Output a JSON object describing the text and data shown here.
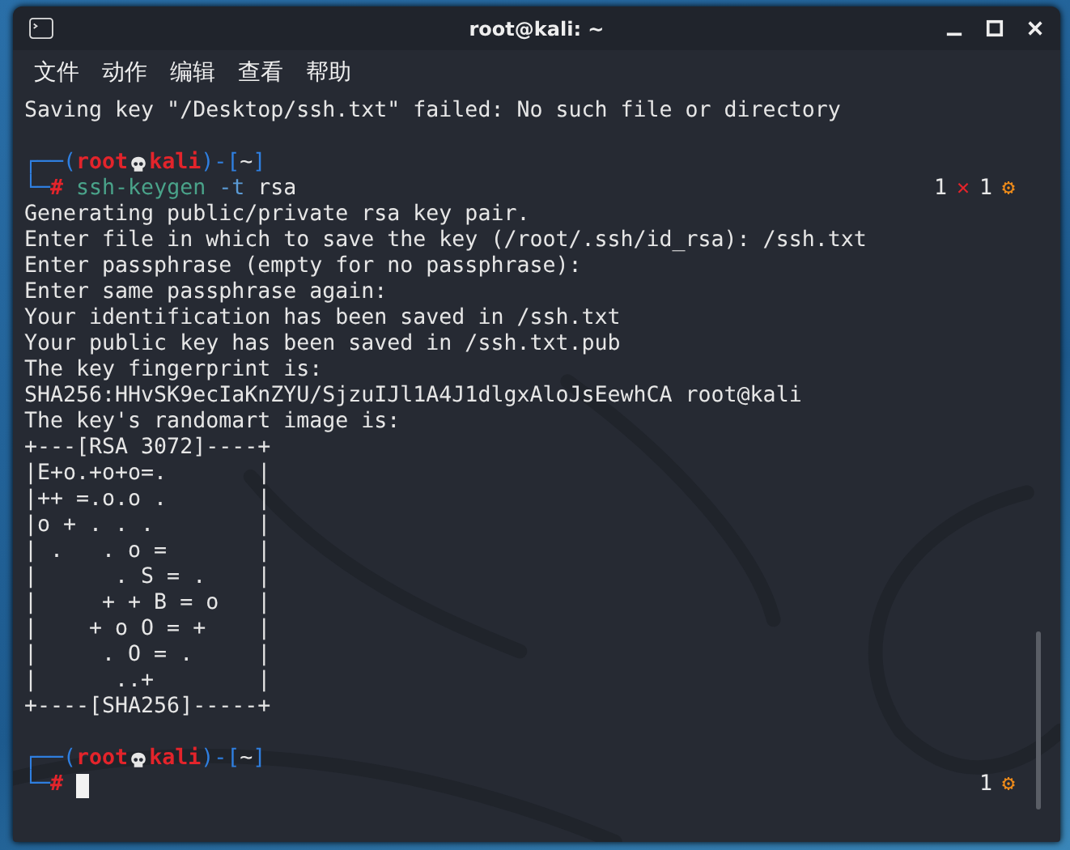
{
  "window": {
    "title": "root@kali: ~"
  },
  "menu": [
    "文件",
    "动作",
    "编辑",
    "查看",
    "帮助"
  ],
  "terminal": {
    "lines": [
      {
        "kind": "output",
        "text": "Saving key \"/Desktop/ssh.txt\" failed: No such file or directory"
      },
      {
        "kind": "blank"
      },
      {
        "kind": "prompt_head",
        "frame_left": "┌──(",
        "user": "root",
        "host": "kali",
        "frame_mid": ")-[",
        "dir": "~",
        "frame_right": "]"
      },
      {
        "kind": "prompt",
        "frame": "└─",
        "symbol": "#",
        "command": "ssh-keygen",
        "option": "-t",
        "args": "rsa",
        "status": [
          {
            "kind": "count",
            "text": "1"
          },
          {
            "kind": "error",
            "text": "✕"
          },
          {
            "kind": "count",
            "text": "1"
          },
          {
            "kind": "gear",
            "text": "⚙"
          }
        ]
      },
      {
        "kind": "output",
        "text": "Generating public/private rsa key pair."
      },
      {
        "kind": "output",
        "text": "Enter file in which to save the key (/root/.ssh/id_rsa): /ssh.txt"
      },
      {
        "kind": "output",
        "text": "Enter passphrase (empty for no passphrase):"
      },
      {
        "kind": "output",
        "text": "Enter same passphrase again:"
      },
      {
        "kind": "output",
        "text": "Your identification has been saved in /ssh.txt"
      },
      {
        "kind": "output",
        "text": "Your public key has been saved in /ssh.txt.pub"
      },
      {
        "kind": "output",
        "text": "The key fingerprint is:"
      },
      {
        "kind": "output",
        "text": "SHA256:HHvSK9ecIaKnZYU/SjzuIJl1A4J1dlgxAloJsEewhCA root@kali"
      },
      {
        "kind": "output",
        "text": "The key's randomart image is:"
      },
      {
        "kind": "output",
        "text": "+---[RSA 3072]----+"
      },
      {
        "kind": "output",
        "text": "|E+o.+o+o=.       |"
      },
      {
        "kind": "output",
        "text": "|++ =.o.o .       |"
      },
      {
        "kind": "output",
        "text": "|o + . . .        |"
      },
      {
        "kind": "output",
        "text": "| .   . o =       |"
      },
      {
        "kind": "output",
        "text": "|      . S = .    |"
      },
      {
        "kind": "output",
        "text": "|     + + B = o   |"
      },
      {
        "kind": "output",
        "text": "|    + o O = +    |"
      },
      {
        "kind": "output",
        "text": "|     . O = .     |"
      },
      {
        "kind": "output",
        "text": "|      ..+        |"
      },
      {
        "kind": "output",
        "text": "+----[SHA256]-----+"
      },
      {
        "kind": "blank"
      },
      {
        "kind": "prompt_head",
        "frame_left": "┌──(",
        "user": "root",
        "host": "kali",
        "frame_mid": ")-[",
        "dir": "~",
        "frame_right": "]"
      },
      {
        "kind": "prompt",
        "frame": "└─",
        "symbol": "#",
        "cursor": true,
        "status": [
          {
            "kind": "count",
            "text": "1"
          },
          {
            "kind": "gear",
            "text": "⚙"
          }
        ]
      }
    ]
  }
}
